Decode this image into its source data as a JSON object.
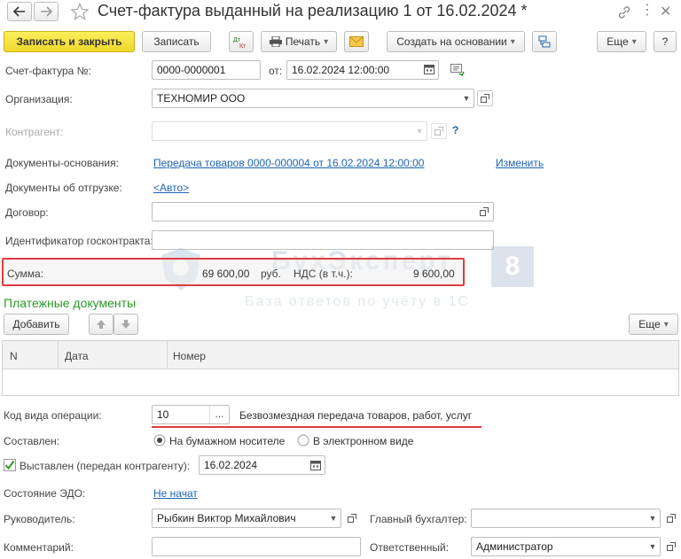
{
  "window": {
    "title": "Счет-фактура выданный на реализацию 1 от 16.02.2024 *"
  },
  "toolbar": {
    "save_close": "Записать и закрыть",
    "save": "Записать",
    "dt_kt": "Дт Кт",
    "print": "Печать",
    "create_based": "Создать на основании",
    "more": "Еще",
    "help": "?"
  },
  "form": {
    "invoice_label": "Счет-фактура №:",
    "invoice_number": "0000-0000001",
    "from_label": "от:",
    "invoice_date": "16.02.2024 12:00:00",
    "org_label": "Организация:",
    "org_value": "ТЕХНОМИР ООО",
    "counterparty_label": "Контрагент:",
    "base_docs_label": "Документы-основания:",
    "base_docs_link": "Передача товаров 0000-000004 от 16.02.2024 12:00:00",
    "change_link": "Изменить",
    "shipping_docs_label": "Документы об отгрузке:",
    "shipping_docs_link": "<Авто>",
    "contract_label": "Договор:",
    "gov_contract_label": "Идентификатор госконтракта:",
    "sum_label": "Сумма:",
    "sum_value": "69 600,00",
    "currency": "руб.",
    "vat_label": "НДС (в т.ч.):",
    "vat_value": "9 600,00"
  },
  "watermark": {
    "title": "БухЭксперт",
    "number": "8",
    "subtitle": "База ответов по учёту в 1С"
  },
  "payments": {
    "heading": "Платежные документы",
    "add": "Добавить",
    "more": "Еще",
    "columns": [
      "N",
      "Дата",
      "Номер"
    ]
  },
  "bottom": {
    "op_code_label": "Код вида операции:",
    "op_code_value": "10",
    "op_code_desc": "Безвозмездная передача товаров, работ, услуг",
    "composed_label": "Составлен:",
    "paper": "На бумажном носителе",
    "electronic": "В электронном виде",
    "issued_label": "Выставлен (передан контрагенту):",
    "issued_date": "16.02.2024",
    "edo_label": "Состояние ЭДО:",
    "edo_link": "Не начат",
    "director_label": "Руководитель:",
    "director_value": "Рыбкин Виктор Михайлович",
    "accountant_label": "Главный бухгалтер:",
    "comment_label": "Комментарий:",
    "responsible_label": "Ответственный:",
    "responsible_value": "Администратор"
  },
  "colors": {
    "accent_yellow": "#f0d72a",
    "link": "#1d64b3",
    "green_heading": "#2a9a2a",
    "highlight_red": "#e23b3b"
  }
}
